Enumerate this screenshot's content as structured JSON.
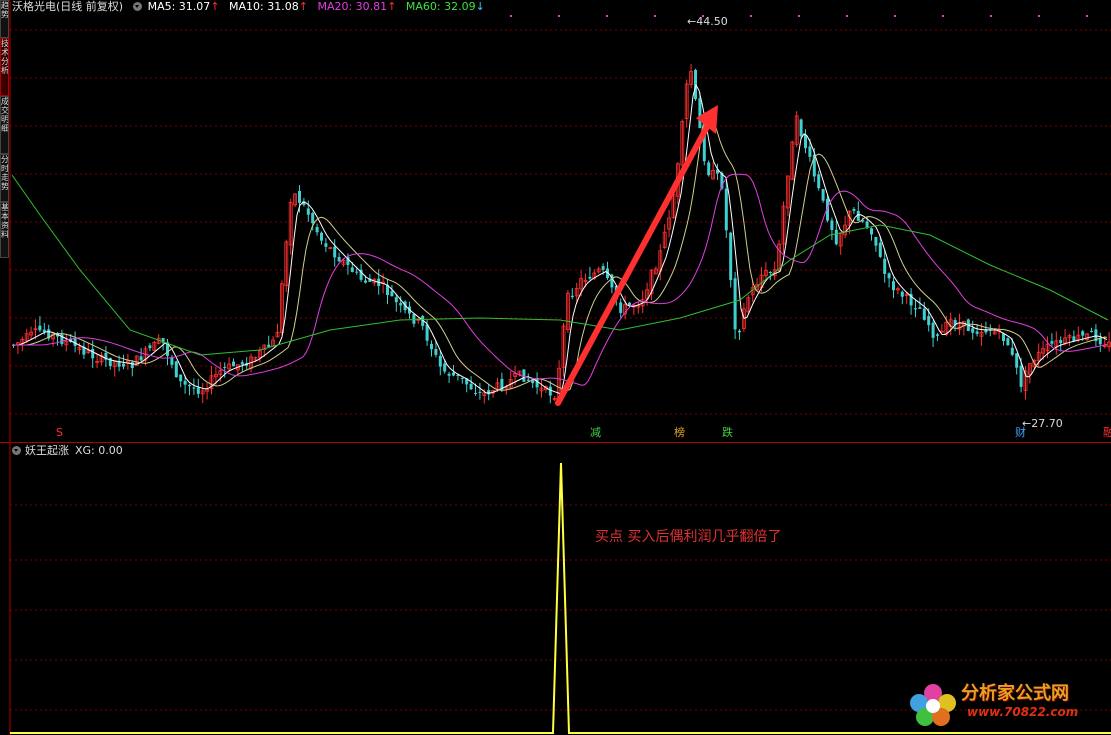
{
  "stock": {
    "name": "沃格光电(日线 前复权)"
  },
  "ma_legend": [
    {
      "label": "MA5: 31.07",
      "arrow": "↑",
      "color": "#ffffff",
      "arrow_color": "#ff3030"
    },
    {
      "label": "MA10: 31.08",
      "arrow": "↑",
      "color": "#ffffff",
      "arrow_color": "#ff3030"
    },
    {
      "label": "MA20: 30.81",
      "arrow": "↑",
      "color": "#e040e0",
      "arrow_color": "#ff3030"
    },
    {
      "label": "MA60: 32.09",
      "arrow": "↓",
      "color": "#40e040",
      "arrow_color": "#40c0ff"
    }
  ],
  "side_tabs": [
    "趋势",
    "技术分析",
    "成交明细",
    "分时走势",
    "基本资料"
  ],
  "price_labels": {
    "high": "44.50",
    "low": "27.70"
  },
  "markers": [
    {
      "text": "S",
      "color": "#ff3030"
    },
    {
      "text": "减",
      "color": "#40d040"
    },
    {
      "text": "榜",
      "color": "#e0a030"
    },
    {
      "text": "跌",
      "color": "#40d040"
    },
    {
      "text": "财",
      "color": "#40a0ff"
    },
    {
      "text": "融",
      "color": "#ff3030"
    }
  ],
  "indicator": {
    "name": "妖王起涨",
    "value_label": "XG: 0.00",
    "signal_value": 1
  },
  "annotation": "买点 买入后偶利润几乎翻倍了",
  "watermark": {
    "title": "分析家公式网",
    "url": "www.70822.com"
  },
  "colors": {
    "up": "#ff3030",
    "down": "#40d0d0",
    "ma5": "#ffffff",
    "ma20": "#e040e0",
    "ma60": "#30c030",
    "signal": "#ffff40",
    "arrow": "#ff3030",
    "grid": "#7a0000"
  }
}
